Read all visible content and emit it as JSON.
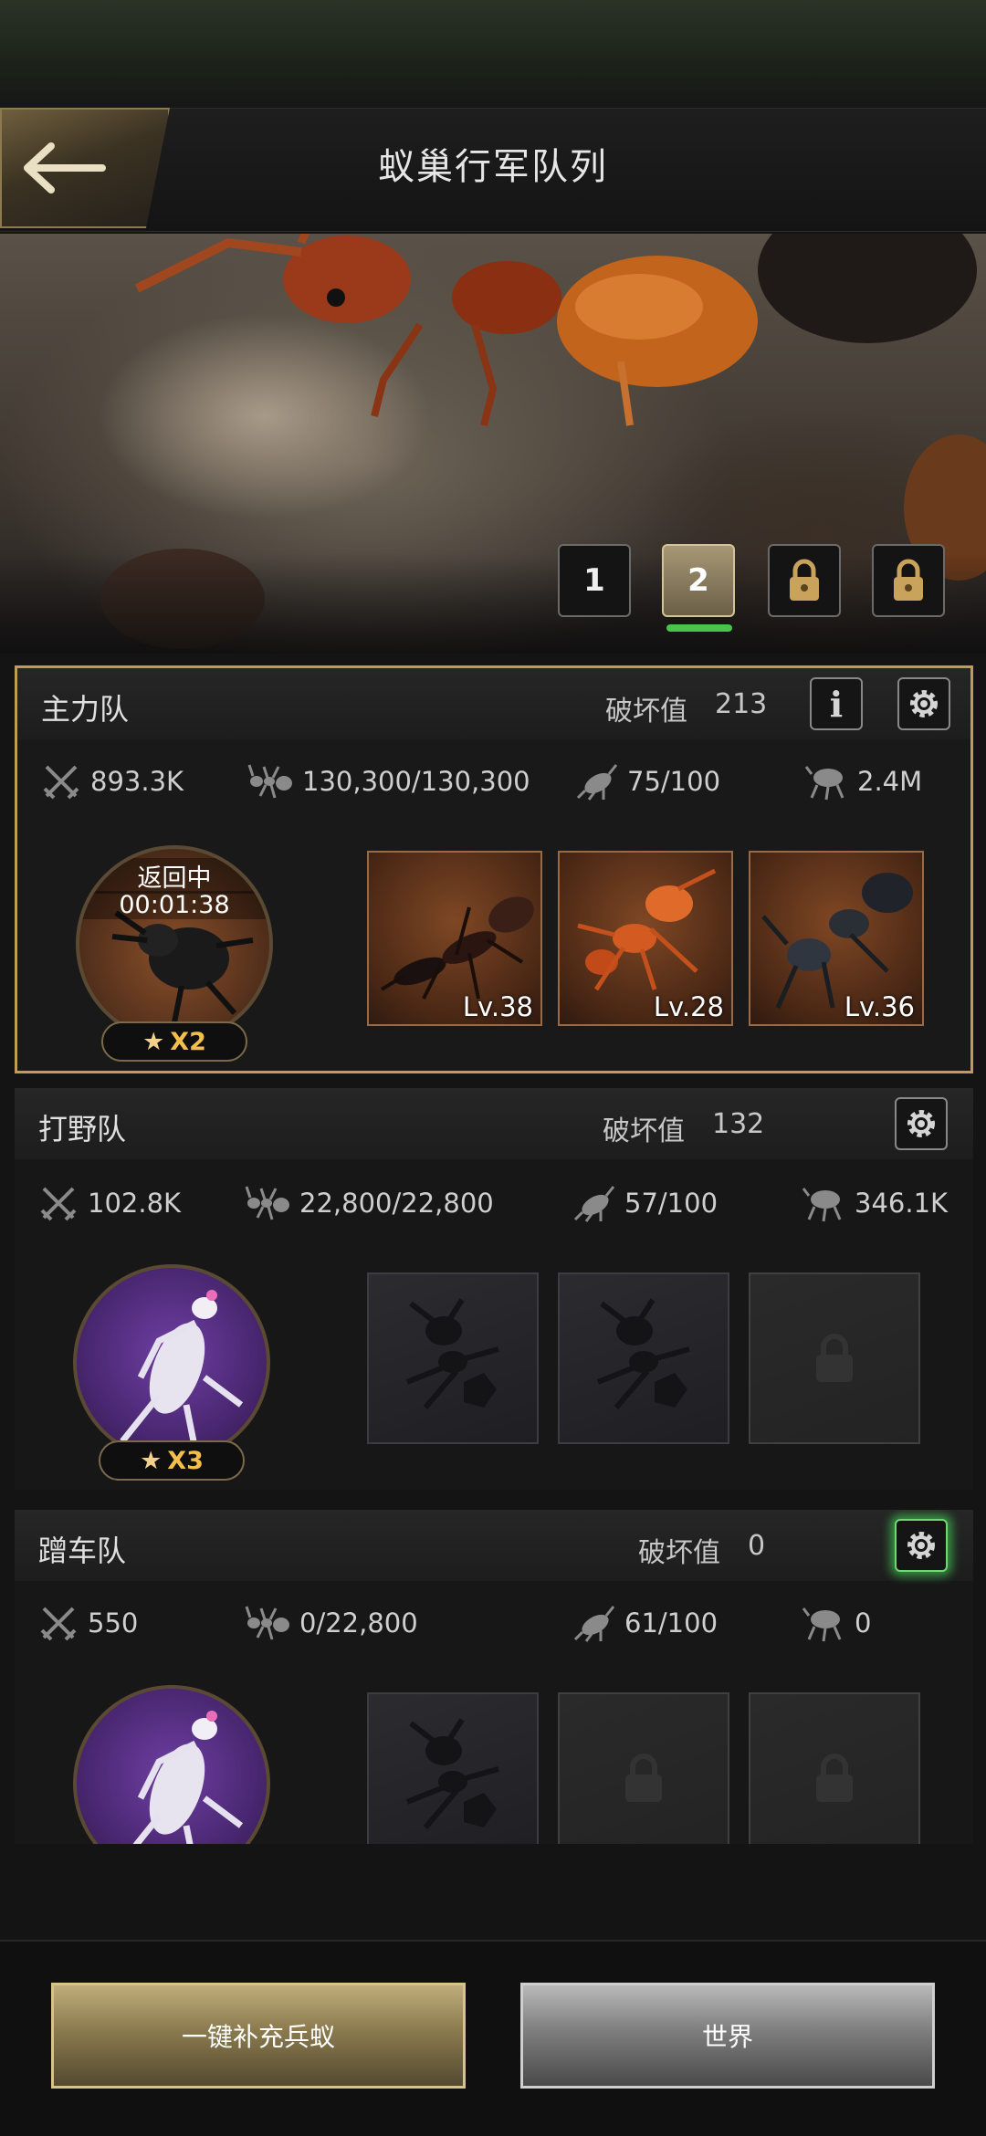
{
  "header": {
    "title": "蚁巢行军队列"
  },
  "pages": [
    "1",
    "2"
  ],
  "squads": [
    {
      "name": "主力队",
      "damage_label": "破坏值",
      "damage_value": "213",
      "stats": {
        "attack": "893.3K",
        "troops": "130,300/130,300",
        "load": "75/100",
        "power": "2.4M"
      },
      "leader": {
        "status": "返回中",
        "timer": "00:01:38",
        "stars": "X2"
      },
      "units": [
        {
          "level": "Lv.38"
        },
        {
          "level": "Lv.28"
        },
        {
          "level": "Lv.36"
        }
      ]
    },
    {
      "name": "打野队",
      "damage_label": "破坏值",
      "damage_value": "132",
      "stats": {
        "attack": "102.8K",
        "troops": "22,800/22,800",
        "load": "57/100",
        "power": "346.1K"
      },
      "leader": {
        "stars": "X3"
      }
    },
    {
      "name": "蹭车队",
      "damage_label": "破坏值",
      "damage_value": "0",
      "stats": {
        "attack": "550",
        "troops": "0/22,800",
        "load": "61/100",
        "power": "0"
      }
    }
  ],
  "footer": {
    "refill_label": "一键补充兵蚁",
    "world_label": "世界"
  },
  "colors": {
    "accent_gold": "#c39c54",
    "indicator_green": "#49c34a"
  }
}
